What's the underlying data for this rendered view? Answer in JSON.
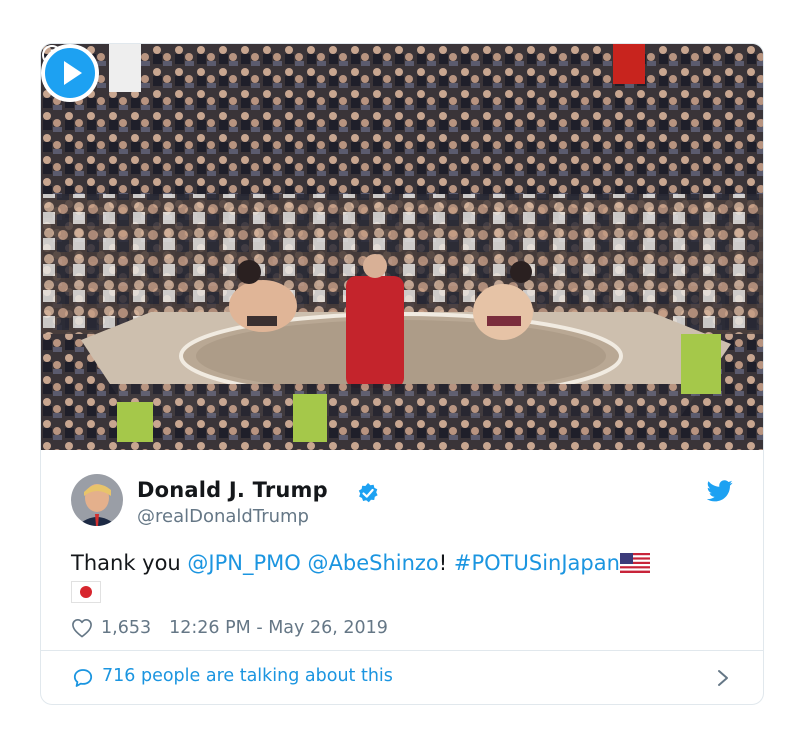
{
  "tweet": {
    "author": {
      "display_name": "Donald J. Trump",
      "handle": "@realDonaldTrump",
      "verified": true
    },
    "text_parts": {
      "prefix": "Thank you ",
      "mention1": "@JPN_PMO",
      "mention2": "@AbeShinzo",
      "exclaim": "!",
      "hashtag": "#POTUSinJapan",
      "flags": [
        "flag-usa-icon",
        "flag-japan-icon"
      ]
    },
    "likes": "1,653",
    "timestamp": "12:26 PM - May 26, 2019",
    "footer_text": "716 people are talking about this"
  },
  "media": {
    "type": "video",
    "description_icons": [
      "play-icon",
      "info-icon"
    ]
  },
  "colors": {
    "link": "#1b95e0",
    "secondary": "#657786",
    "border": "#e1e8ed",
    "twitter_brand": "#1da1f2",
    "verified": "#1da1f2"
  }
}
